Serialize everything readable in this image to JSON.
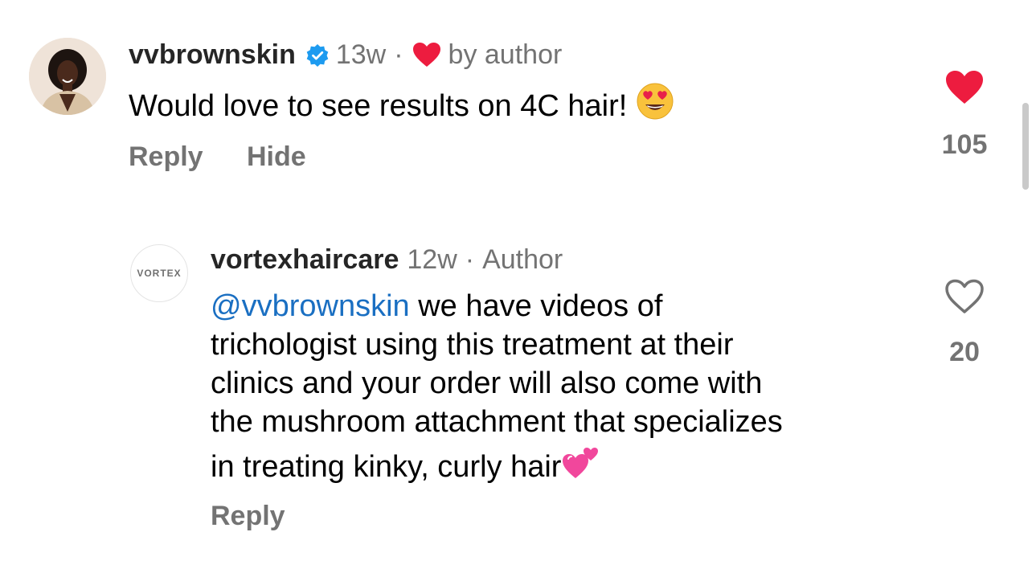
{
  "comments": [
    {
      "username": "vvbrownskin",
      "verified_icon": "verified-badge-icon",
      "time": "13w",
      "liked_by_author_label": "by author",
      "text": "Would love to see results on 4C hair!",
      "text_emoji": "heart-eyes-emoji",
      "reply_label": "Reply",
      "hide_label": "Hide",
      "like_icon": "heart-filled-icon",
      "like_count": "105",
      "like_color": "#ed1c3f"
    },
    {
      "username": "vortexhaircare",
      "time": "12w",
      "author_label": "Author",
      "avatar_text": "VORTEX",
      "mention": "@vvbrownskin",
      "text_line1_rest": " we have videos of",
      "text_line2": "trichologist using this treatment at their",
      "text_line3": "clinics and your order will also come with",
      "text_line4": "the mushroom attachment that specializes",
      "text_line5": "in treating kinky, curly hair",
      "text_emoji": "two-hearts-emoji",
      "reply_label": "Reply",
      "like_icon": "heart-outline-icon",
      "like_count": "20"
    }
  ],
  "colors": {
    "mention": "#1a6fc2",
    "muted": "#737373",
    "heart_red": "#ed1c3f",
    "verified_blue": "#1d9bf0"
  }
}
